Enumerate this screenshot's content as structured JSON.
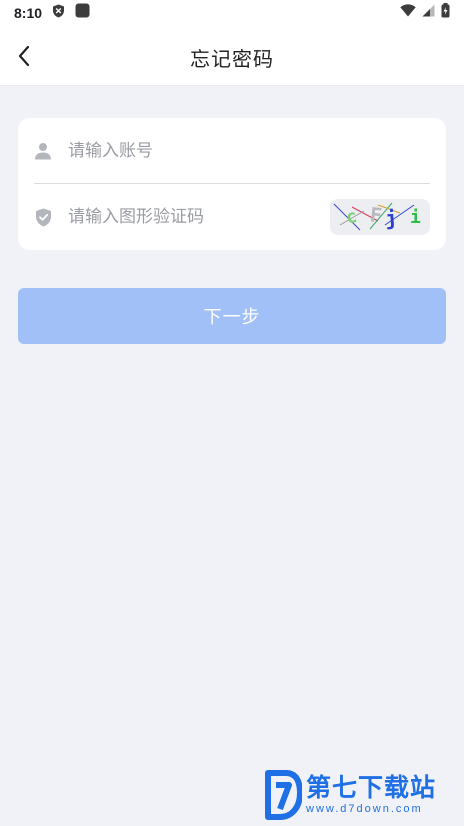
{
  "status_bar": {
    "time": "8:10"
  },
  "header": {
    "title": "忘记密码"
  },
  "form": {
    "account_placeholder": "请输入账号",
    "captcha_placeholder": "请输入图形验证码",
    "captcha_text": "cFji"
  },
  "actions": {
    "next_label": "下一步"
  },
  "watermark": {
    "name": "第七下载站",
    "url": "www.d7down.com"
  },
  "colors": {
    "primary_disabled": "#a0c0f7",
    "background": "#f1f2f8",
    "watermark_blue": "#1f6fe5"
  }
}
